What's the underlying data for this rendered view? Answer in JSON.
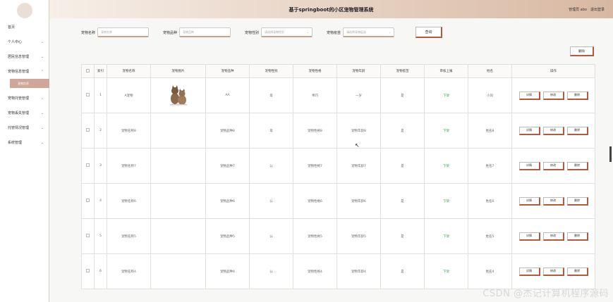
{
  "header": {
    "title": "基于springboot的小区宠物管理系统",
    "role": "管理员 abo",
    "logout": "退出登录"
  },
  "sidebar": {
    "items": [
      {
        "label": "首页",
        "chev": ""
      },
      {
        "label": "个人中心",
        "chev": "⌄"
      },
      {
        "label": "居民信息管理",
        "chev": "⌄"
      },
      {
        "label": "宠物信息管理",
        "chev": "⌃"
      },
      {
        "label": "宠物信息",
        "chev": ""
      },
      {
        "label": "宠物托管管理",
        "chev": "⌄"
      },
      {
        "label": "宠物丢失管理",
        "chev": "⌄"
      },
      {
        "label": "托管情况管理",
        "chev": "⌄"
      },
      {
        "label": "系统管理",
        "chev": "⌄"
      }
    ]
  },
  "search": {
    "name_label": "宠物名称",
    "name_placeholder": "宠物名称",
    "breed_label": "宠物品种",
    "breed_placeholder": "宠物品种",
    "gender_label": "宠物性别",
    "gender_placeholder": "请选择宠物性别",
    "vaccine_label": "宠物疫苗",
    "vaccine_placeholder": "请选择宠物疫苗",
    "query_label": "查询"
  },
  "toolbar": {
    "delete_label": "删除"
  },
  "table": {
    "headers": [
      "",
      "索引",
      "宠物名称",
      "宠物图片",
      "宠物品种",
      "宠物性别",
      "宠物性格",
      "宠物年龄",
      "宠物疫苗",
      "审核上报",
      "姓名",
      "操作"
    ],
    "rows": [
      {
        "idx": "1",
        "name": "A宠物",
        "img": "cat",
        "breed": "AA",
        "gender": "母",
        "char": "乖巧",
        "age": "一岁",
        "vaccine": "是",
        "status": "下架",
        "owner": "小凤"
      },
      {
        "idx": "2",
        "name": "宠物名称8",
        "img": "",
        "breed": "宠物品种8",
        "gender": "母",
        "char": "宠物性格8",
        "age": "宠物年龄8",
        "vaccine": "是",
        "status": "下架",
        "owner": "姓名8"
      },
      {
        "idx": "3",
        "name": "宠物名称7",
        "img": "",
        "breed": "宠物品种7",
        "gender": "公",
        "char": "宠物性格7",
        "age": "宠物年龄7",
        "vaccine": "是",
        "status": "下架",
        "owner": "姓名7"
      },
      {
        "idx": "4",
        "name": "宠物名称6",
        "img": "",
        "breed": "宠物品种6",
        "gender": "公",
        "char": "宠物性格6",
        "age": "宠物年龄6",
        "vaccine": "是",
        "status": "下架",
        "owner": "姓名6"
      },
      {
        "idx": "5",
        "name": "宠物名称5",
        "img": "",
        "breed": "宠物品种5",
        "gender": "公",
        "char": "宠物性格5",
        "age": "宠物年龄5",
        "vaccine": "是",
        "status": "下架",
        "owner": "姓名5"
      },
      {
        "idx": "6",
        "name": "宠物名称4",
        "img": "",
        "breed": "宠物品种4",
        "gender": "公",
        "char": "宠物性格4",
        "age": "宠物年龄4",
        "vaccine": "是",
        "status": "下架",
        "owner": "姓名4"
      }
    ],
    "ops": {
      "detail": "详情",
      "edit": "修改",
      "delete": "删除"
    }
  },
  "watermark": "CSDN @杰记计算机程序源码",
  "colors": {
    "accent": "#b35a3e",
    "header_start": "#f7efe8",
    "header_end": "#d8b8a2",
    "status": "#2aa048",
    "active_menu": "#cfa697"
  }
}
